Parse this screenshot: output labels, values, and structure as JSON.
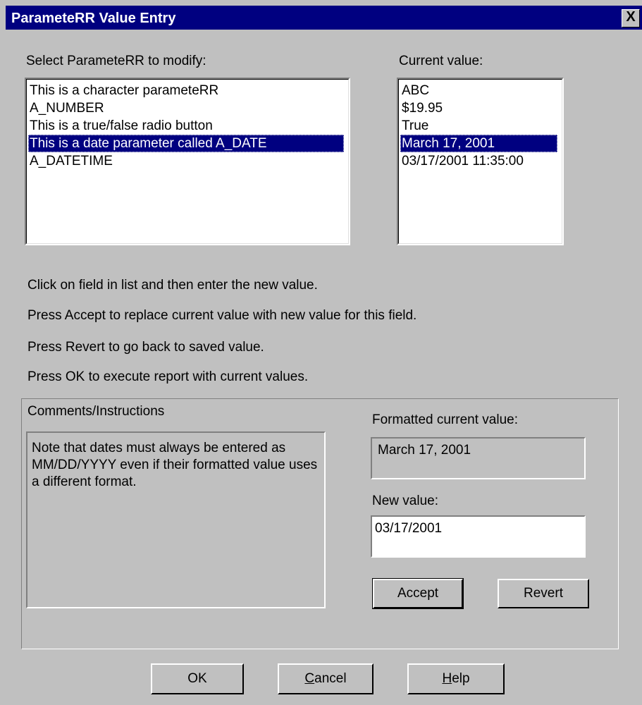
{
  "window": {
    "title": "ParameteRR Value Entry",
    "close_glyph": "X"
  },
  "select_label": "Select ParameteRR to modify:",
  "current_label": "Current value:",
  "parameters": [
    "This is a character parameteRR",
    "A_NUMBER",
    "This is a true/false radio button",
    "This is a date parameter called A_DATE",
    "A_DATETIME"
  ],
  "current_values": [
    "ABC",
    "$19.95",
    "True",
    "March 17, 2001",
    "03/17/2001 11:35:00"
  ],
  "selected_index": 3,
  "instructions": [
    "Click on field in list and then enter the new value.",
    "Press Accept to replace current value with new value for this field.",
    "Press Revert to go back to saved value.",
    "Press OK to execute report with current values."
  ],
  "comments": {
    "label": "Comments/Instructions",
    "text": "Note that dates must always be entered as MM/DD/YYYY even if their formatted value uses a different format."
  },
  "formatted": {
    "label": "Formatted current value:",
    "value": "March 17, 2001"
  },
  "new_value": {
    "label": "New value:",
    "value": "03/17/2001"
  },
  "buttons": {
    "accept": "Accept",
    "revert": "Revert",
    "ok": "OK",
    "cancel_mnemonic": "C",
    "cancel_rest": "ancel",
    "help_mnemonic": "H",
    "help_rest": "elp"
  },
  "colors": {
    "face": "#c0c0c0",
    "title_bar": "#000080",
    "selection": "#000080"
  }
}
